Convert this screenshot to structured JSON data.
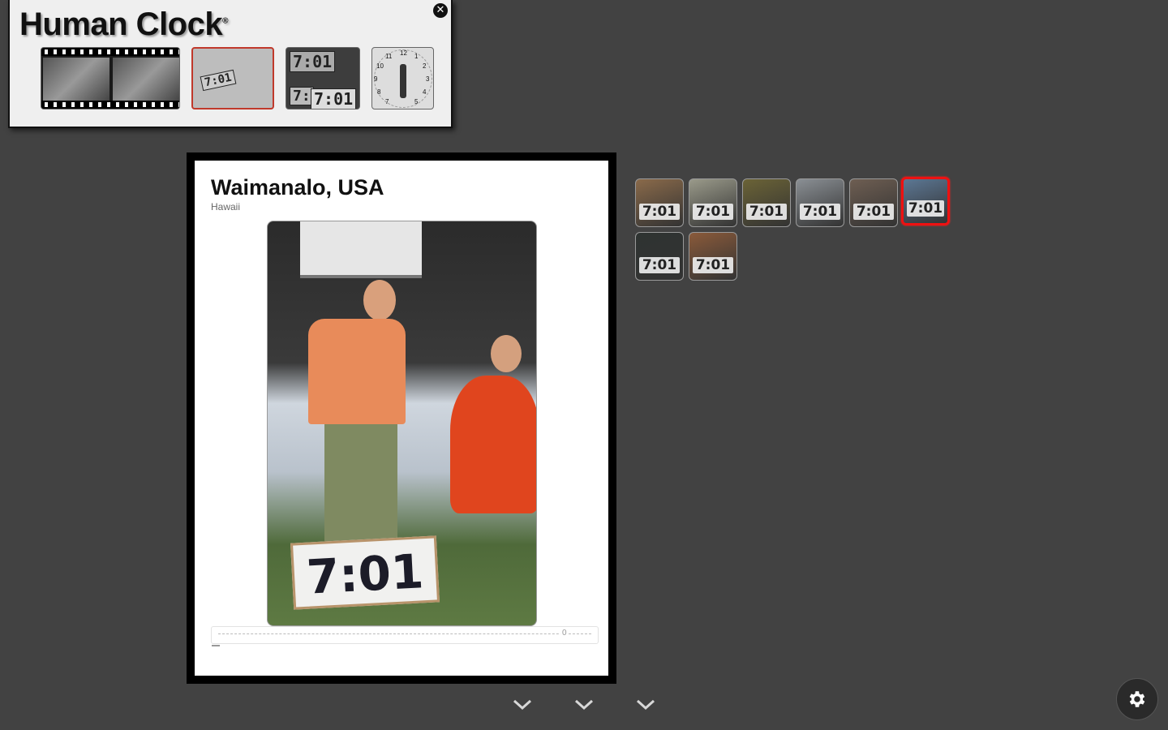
{
  "brand": {
    "title": "Human Clock",
    "registered_mark": "®",
    "close_icon": "close-icon",
    "apps": [
      {
        "name": "film-strip-app",
        "icon": "film-strip-thumb"
      },
      {
        "name": "photo-app",
        "icon": "photo-thumb",
        "label": "7:01"
      },
      {
        "name": "collage-app",
        "icon": "collage-thumb",
        "labels": [
          "7:01",
          "7:",
          "7:01"
        ]
      },
      {
        "name": "clock-face-app",
        "icon": "clock-face-thumb",
        "numbers": [
          "12",
          "1",
          "2",
          "3",
          "4",
          "5",
          "7",
          "8",
          "9",
          "10",
          "11"
        ]
      }
    ]
  },
  "photo": {
    "location": "Waimanalo, USA",
    "region": "Hawaii",
    "sign_text": "7:01",
    "progress_label": "0",
    "progress_fraction": 0.02
  },
  "thumbnails": [
    {
      "label": "7:01",
      "bg": "#8a6a4a",
      "selected": false
    },
    {
      "label": "7:01",
      "bg": "#9a9a8a",
      "selected": false
    },
    {
      "label": "7:01",
      "bg": "#6b6336",
      "selected": false
    },
    {
      "label": "7:01",
      "bg": "#8a8f94",
      "selected": false
    },
    {
      "label": "7:01",
      "bg": "#6e5e52",
      "selected": false
    },
    {
      "label": "7:01",
      "bg": "#5c7794",
      "selected": true
    },
    {
      "label": "7:01",
      "bg": "#2e3331",
      "selected": false
    },
    {
      "label": "7:01",
      "bg": "#8a5a3a",
      "selected": false
    }
  ],
  "nav": {
    "chevrons": [
      "chevron-down-icon",
      "chevron-down-icon",
      "chevron-down-icon"
    ]
  },
  "settings": {
    "icon": "gear-icon"
  },
  "colors": {
    "background": "#424242",
    "selected_border": "#e11111",
    "panel": "#efefef"
  }
}
